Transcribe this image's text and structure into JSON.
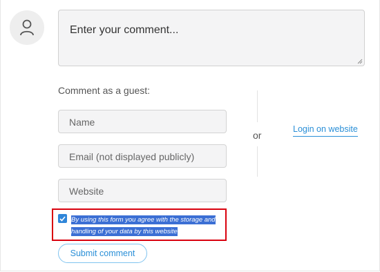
{
  "comment": {
    "placeholder": "Enter your comment..."
  },
  "guest": {
    "label": "Comment as a guest:"
  },
  "fields": {
    "name_placeholder": "Name",
    "email_placeholder": "Email (not displayed publicly)",
    "website_placeholder": "Website"
  },
  "divider": {
    "or_label": "or"
  },
  "login": {
    "label": "Login on website"
  },
  "consent": {
    "checked": true,
    "text_line1": "By using this form you agree with the storage and",
    "text_line2": "handling of your data by this website"
  },
  "submit": {
    "label": "Submit comment"
  },
  "colors": {
    "accent": "#2a8fd7",
    "checkbox": "#2f86d9",
    "selection": "#3b6fd4",
    "highlight_outline": "#d9000d"
  },
  "icons": {
    "avatar": "user-icon",
    "checkbox": "checkmark-icon",
    "resize": "resize-handle-icon"
  }
}
